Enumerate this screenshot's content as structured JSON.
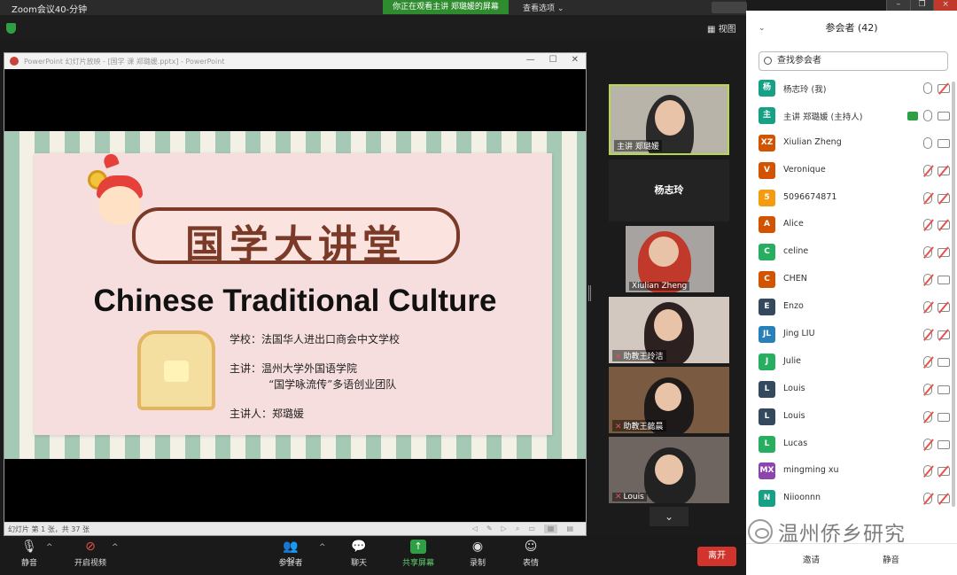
{
  "window": {
    "app_title": "Zoom会议40-分钟",
    "share_banner": "你正在观看主讲 郑璐媛的屏幕",
    "view_options": "查看选项 ⌄",
    "view_label": "视图"
  },
  "presentation": {
    "window_title": "PowerPoint 幻灯片放映 - [国学 课 郑璐媛.pptx] - PowerPoint",
    "slide_banner": "国学大讲堂",
    "slide_subtitle": "Chinese Traditional Culture",
    "school_line": "学校：法国华人进出口商会中文学校",
    "host_line1": "主讲：温州大学外国语学院",
    "host_line2": "“国学咏流传”多语创业团队",
    "speaker_line": "主讲人：郑璐媛",
    "status": "幻灯片 第 1 张，共 37 张"
  },
  "videos": [
    {
      "name": "主讲 郑璐媛",
      "muted": false
    },
    {
      "name": "杨志玲",
      "muted": false
    },
    {
      "name": "Xiulian Zheng",
      "muted": false
    },
    {
      "name": "助教王玲洁",
      "muted": true
    },
    {
      "name": "助教王懿晨",
      "muted": true
    },
    {
      "name": "Louis",
      "muted": true
    }
  ],
  "toolbar": {
    "mute": "静音",
    "video": "开启视频",
    "participants": "参会者",
    "participants_count": "42",
    "chat": "聊天",
    "share": "共享屏幕",
    "record": "录制",
    "reactions": "表情",
    "leave": "离开"
  },
  "panel": {
    "title": "参会者 (42)",
    "search_placeholder": "查找参会者",
    "invite": "邀请",
    "mute_all": "静音",
    "participants": [
      {
        "initials": "杨",
        "name": "杨志玲 (我)",
        "color": "#16a085",
        "mic_muted": false,
        "cam_muted": true,
        "sharing": false
      },
      {
        "initials": "主",
        "name": "主讲 郑璐媛 (主持人)",
        "color": "#16a085",
        "mic_muted": false,
        "cam_muted": false,
        "sharing": true
      },
      {
        "initials": "XZ",
        "name": "Xiulian Zheng",
        "color": "#d35400",
        "mic_muted": false,
        "cam_muted": false,
        "sharing": false
      },
      {
        "initials": "V",
        "name": "Veronique",
        "color": "#d35400",
        "mic_muted": true,
        "cam_muted": true,
        "sharing": false
      },
      {
        "initials": "5",
        "name": "5096674871",
        "color": "#f39c12",
        "mic_muted": true,
        "cam_muted": true,
        "sharing": false
      },
      {
        "initials": "A",
        "name": "Alice",
        "color": "#d35400",
        "mic_muted": true,
        "cam_muted": true,
        "sharing": false
      },
      {
        "initials": "C",
        "name": "celine",
        "color": "#27ae60",
        "mic_muted": true,
        "cam_muted": true,
        "sharing": false
      },
      {
        "initials": "C",
        "name": "CHEN",
        "color": "#d35400",
        "mic_muted": true,
        "cam_muted": false,
        "sharing": false
      },
      {
        "initials": "E",
        "name": "Enzo",
        "color": "#34495e",
        "mic_muted": true,
        "cam_muted": true,
        "sharing": false
      },
      {
        "initials": "JL",
        "name": "Jing LIU",
        "color": "#2980b9",
        "mic_muted": true,
        "cam_muted": true,
        "sharing": false
      },
      {
        "initials": "J",
        "name": "Julie",
        "color": "#27ae60",
        "mic_muted": true,
        "cam_muted": false,
        "sharing": false
      },
      {
        "initials": "L",
        "name": "Louis",
        "color": "#34495e",
        "mic_muted": true,
        "cam_muted": false,
        "sharing": false
      },
      {
        "initials": "L",
        "name": "Louis",
        "color": "#34495e",
        "mic_muted": true,
        "cam_muted": false,
        "sharing": false
      },
      {
        "initials": "L",
        "name": "Lucas",
        "color": "#27ae60",
        "mic_muted": true,
        "cam_muted": false,
        "sharing": false
      },
      {
        "initials": "MX",
        "name": "mingming xu",
        "color": "#8e44ad",
        "mic_muted": true,
        "cam_muted": true,
        "sharing": false
      },
      {
        "initials": "N",
        "name": "Niioonnn",
        "color": "#16a085",
        "mic_muted": true,
        "cam_muted": true,
        "sharing": false
      }
    ]
  },
  "watermark": {
    "text": "温州侨乡研究"
  }
}
